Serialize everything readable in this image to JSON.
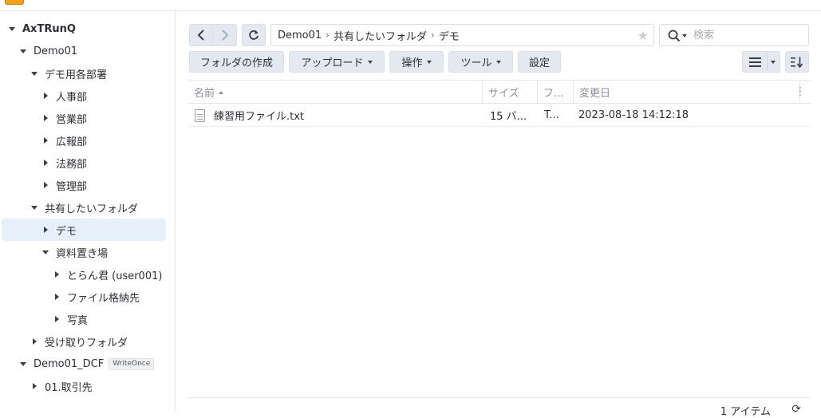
{
  "sidebar": {
    "items": [
      {
        "label": "AxTRunQ"
      },
      {
        "label": "Demo01"
      },
      {
        "label": "デモ用各部署"
      },
      {
        "label": "人事部"
      },
      {
        "label": "営業部"
      },
      {
        "label": "広報部"
      },
      {
        "label": "法務部"
      },
      {
        "label": "管理部"
      },
      {
        "label": "共有したいフォルダ"
      },
      {
        "label": "デモ"
      },
      {
        "label": "資料置き場"
      },
      {
        "label": "とらん君 (user001)"
      },
      {
        "label": "ファイル格納先"
      },
      {
        "label": "写真"
      },
      {
        "label": "受け取りフォルダ"
      },
      {
        "label": "Demo01_DCF",
        "tag": "WriteOnce"
      },
      {
        "label": "01.取引先"
      }
    ]
  },
  "path": {
    "crumbs": [
      "Demo01",
      "共有したいフォルダ",
      "デモ"
    ]
  },
  "search": {
    "placeholder": "検索"
  },
  "toolbar": {
    "create_folder": "フォルダの作成",
    "upload": "アップロード",
    "action": "操作",
    "tools": "ツール",
    "settings": "設定"
  },
  "columns": {
    "name": "名前",
    "size": "サイズ",
    "type": "フ...",
    "modified": "変更日"
  },
  "files": [
    {
      "name": "練習用ファイル.txt",
      "size": "15 バ...",
      "type": "T...",
      "modified": "2023-08-18 14:12:18"
    }
  ],
  "footer": {
    "item_count": "1 アイテム"
  },
  "colors": {
    "accent_selected": "#e6f0fb",
    "button_bg": "#e4e9f0",
    "logo": "#f0a21d"
  }
}
